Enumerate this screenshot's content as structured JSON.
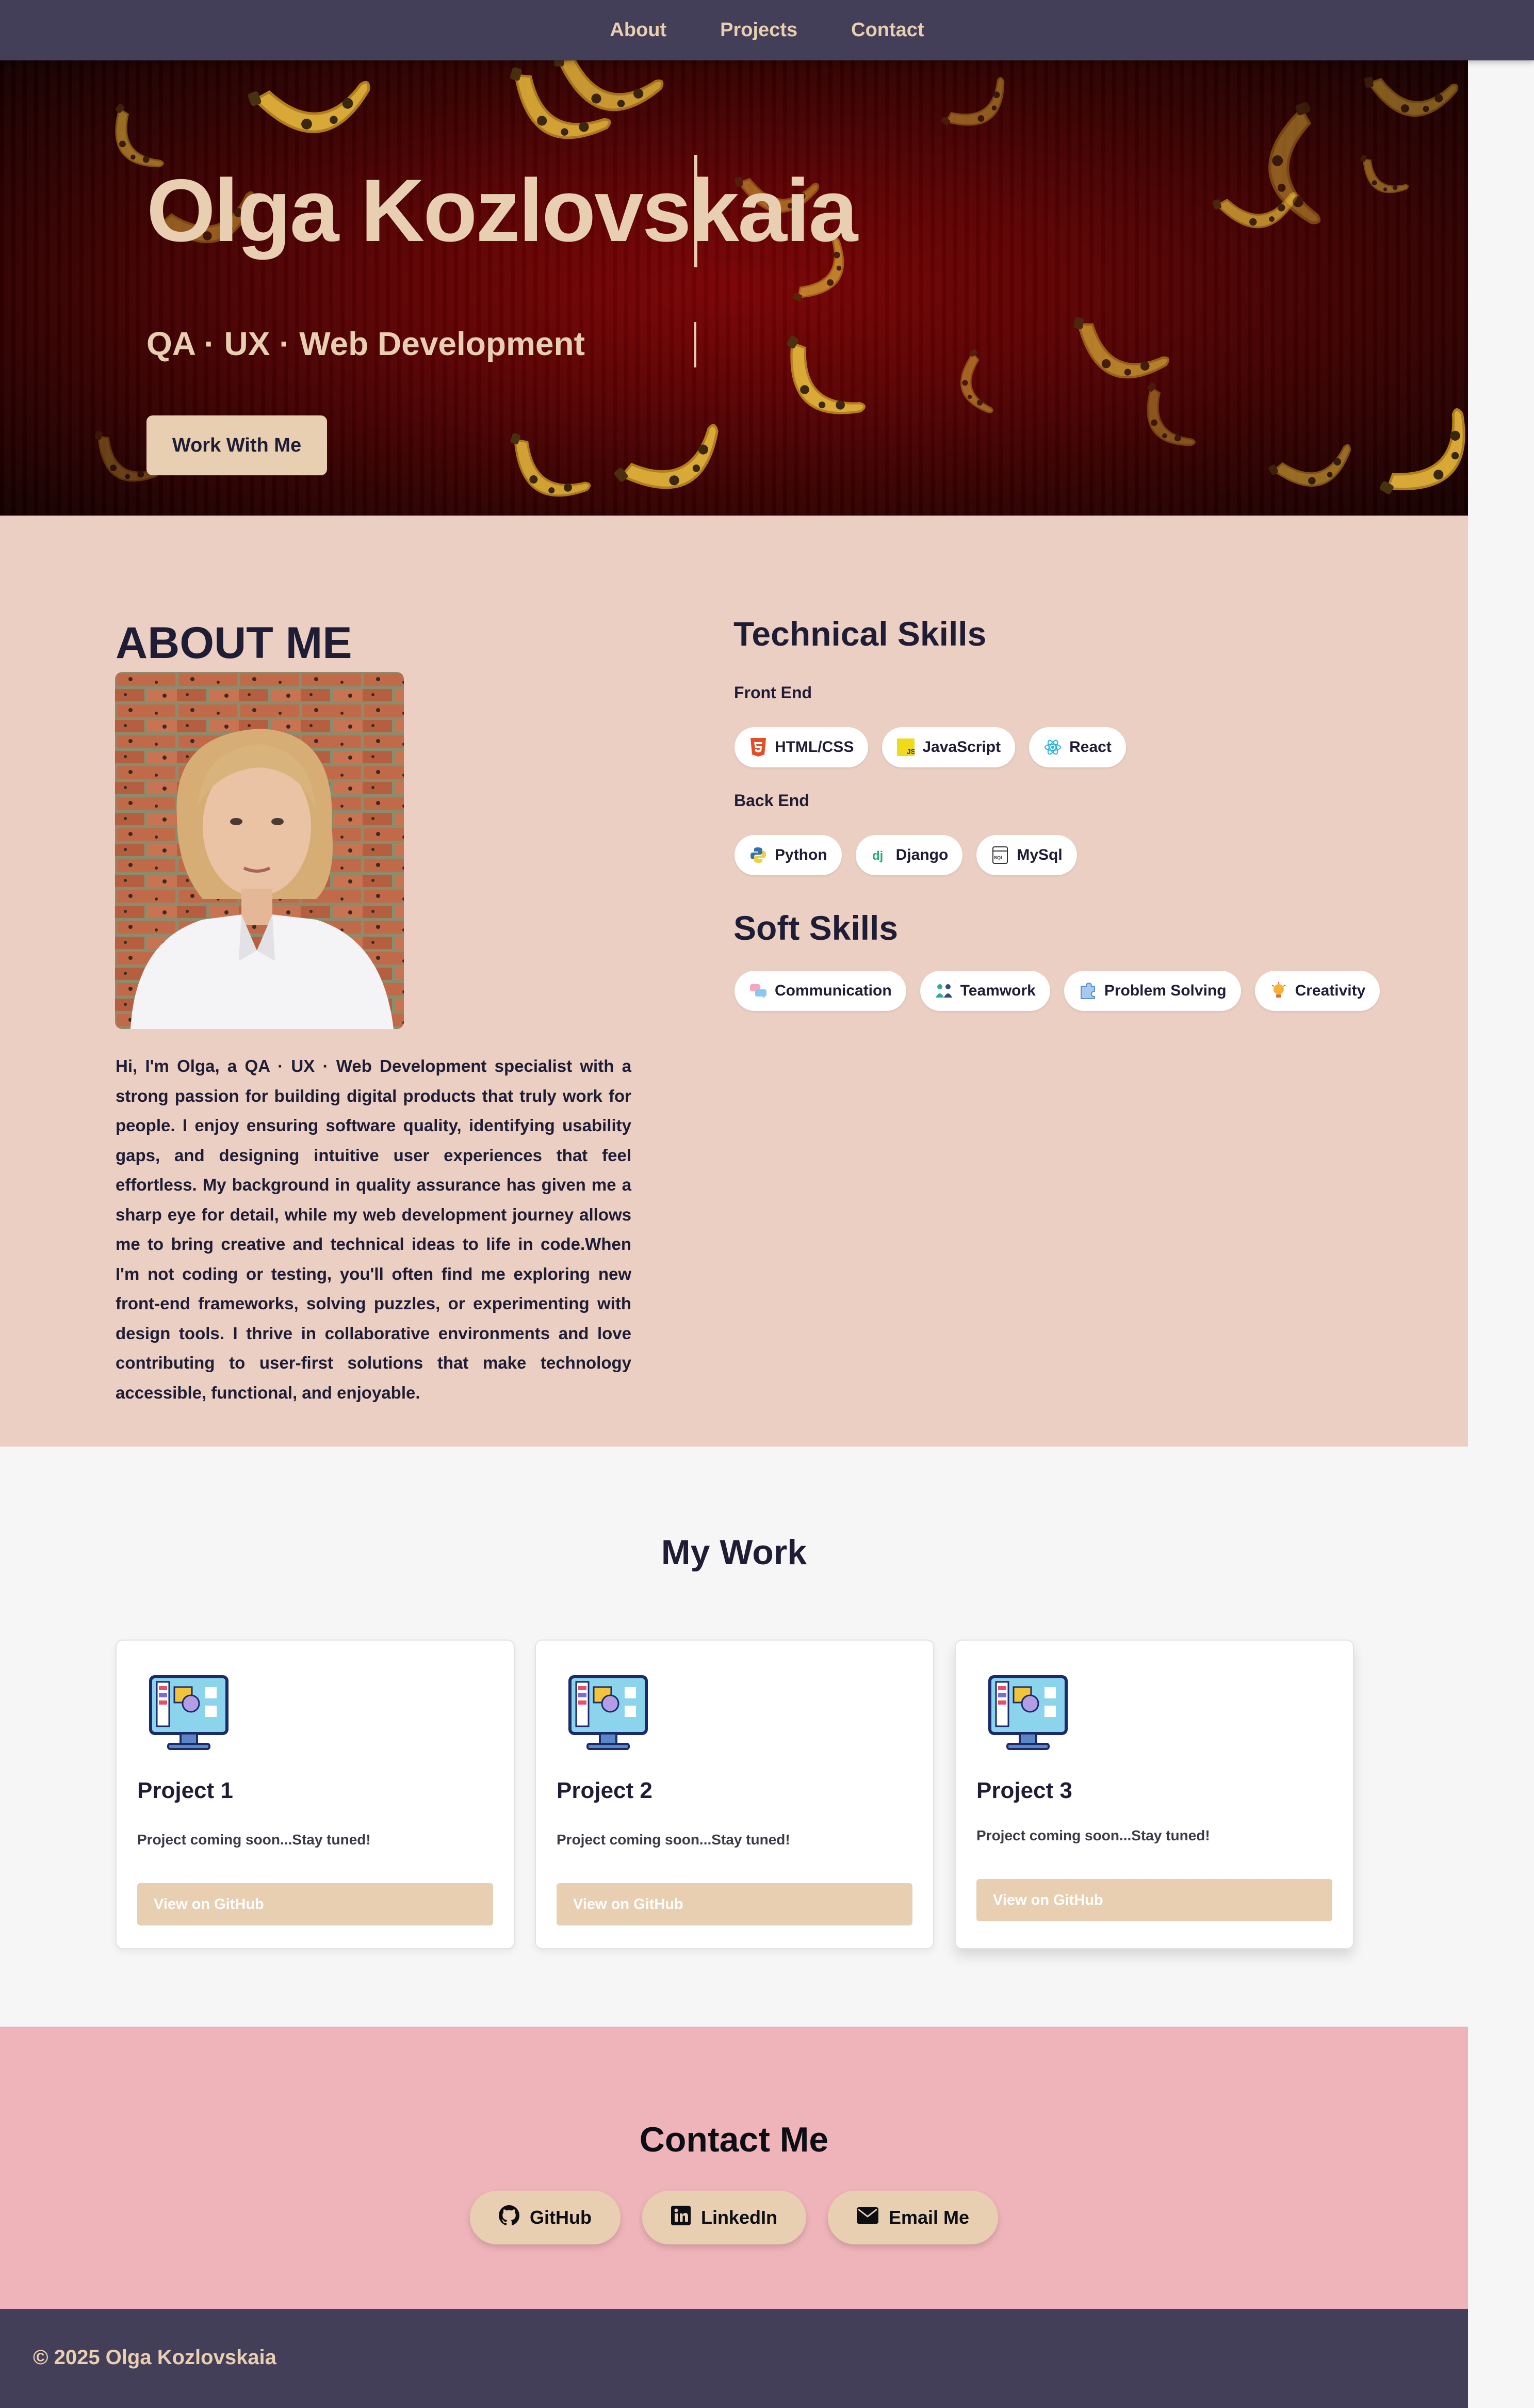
{
  "nav": {
    "items": [
      "About",
      "Projects",
      "Contact"
    ]
  },
  "hero": {
    "name": "Olga Kozlovskaia",
    "subtitle": "QA · UX · Web Development",
    "cta_label": "Work With Me"
  },
  "about": {
    "title": "ABOUT ME",
    "bio": "Hi, I'm Olga, a QA · UX · Web Development specialist with a strong passion for building digital products that truly work for people. I enjoy ensuring software quality, identifying usability gaps, and designing intuitive user experiences that feel effortless. My background in quality assurance has given me a sharp eye for detail, while my web development journey allows me to bring creative and technical ideas to life in code.When I'm not coding or testing, you'll often find me exploring new front-end frameworks, solving puzzles, or experimenting with design tools. I thrive in collaborative environments and love contributing to user-first solutions that make technology accessible, functional, and enjoyable."
  },
  "skills": {
    "technical_title": "Technical Skills",
    "front_end_label": "Front End",
    "front_end": [
      {
        "label": "HTML/CSS",
        "icon": "html5-icon"
      },
      {
        "label": "JavaScript",
        "icon": "javascript-icon"
      },
      {
        "label": "React",
        "icon": "react-icon"
      }
    ],
    "back_end_label": "Back End",
    "back_end": [
      {
        "label": "Python",
        "icon": "python-icon"
      },
      {
        "label": "Django",
        "icon": "django-icon"
      },
      {
        "label": "MySql",
        "icon": "mysql-icon"
      }
    ],
    "soft_title": "Soft Skills",
    "soft": [
      {
        "label": "Communication",
        "icon": "chat-bubbles-icon"
      },
      {
        "label": "Teamwork",
        "icon": "team-icon"
      },
      {
        "label": "Problem Solving",
        "icon": "puzzle-icon"
      },
      {
        "label": "Creativity",
        "icon": "lightbulb-icon"
      }
    ]
  },
  "work": {
    "title": "My Work",
    "projects": [
      {
        "title": "Project 1",
        "text": "Project coming soon...Stay tuned!",
        "button": "View on GitHub"
      },
      {
        "title": "Project 2",
        "text": "Project coming soon...Stay tuned!",
        "button": "View on GitHub"
      },
      {
        "title": "Project 3",
        "text": "Project coming soon...Stay tuned!",
        "button": "View on GitHub"
      }
    ]
  },
  "contact": {
    "title": "Contact Me",
    "links": [
      {
        "label": "GitHub",
        "icon": "github-icon"
      },
      {
        "label": "LinkedIn",
        "icon": "linkedin-icon"
      },
      {
        "label": "Email Me",
        "icon": "envelope-icon"
      }
    ]
  },
  "footer": {
    "text": "© 2025 Olga Kozlovskaia"
  },
  "colors": {
    "nav_bg": "#443f58",
    "accent": "#e8cfb1",
    "hero_red": "#7a0304",
    "about_bg": "#ebcfc3",
    "contact_bg": "#efb4b9",
    "text_dark": "#1f1d36"
  }
}
